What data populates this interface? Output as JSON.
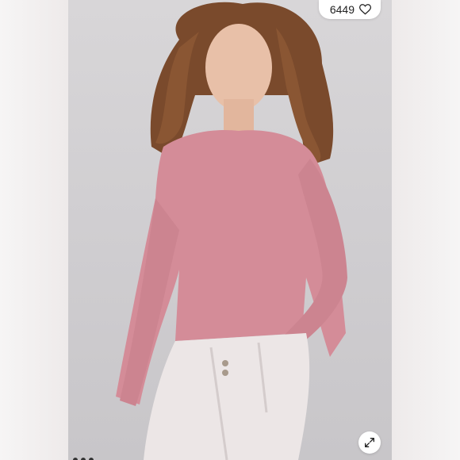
{
  "likes": {
    "count": "6449",
    "icon": "heart-outline-icon"
  },
  "expand": {
    "icon": "expand-arrows-icon"
  },
  "photo": {
    "subject": "model",
    "top_color": "#d48c98",
    "pants_color": "#ece6e6"
  },
  "colors": {
    "background": "#f4f3f3",
    "pill": "#ffffff"
  }
}
